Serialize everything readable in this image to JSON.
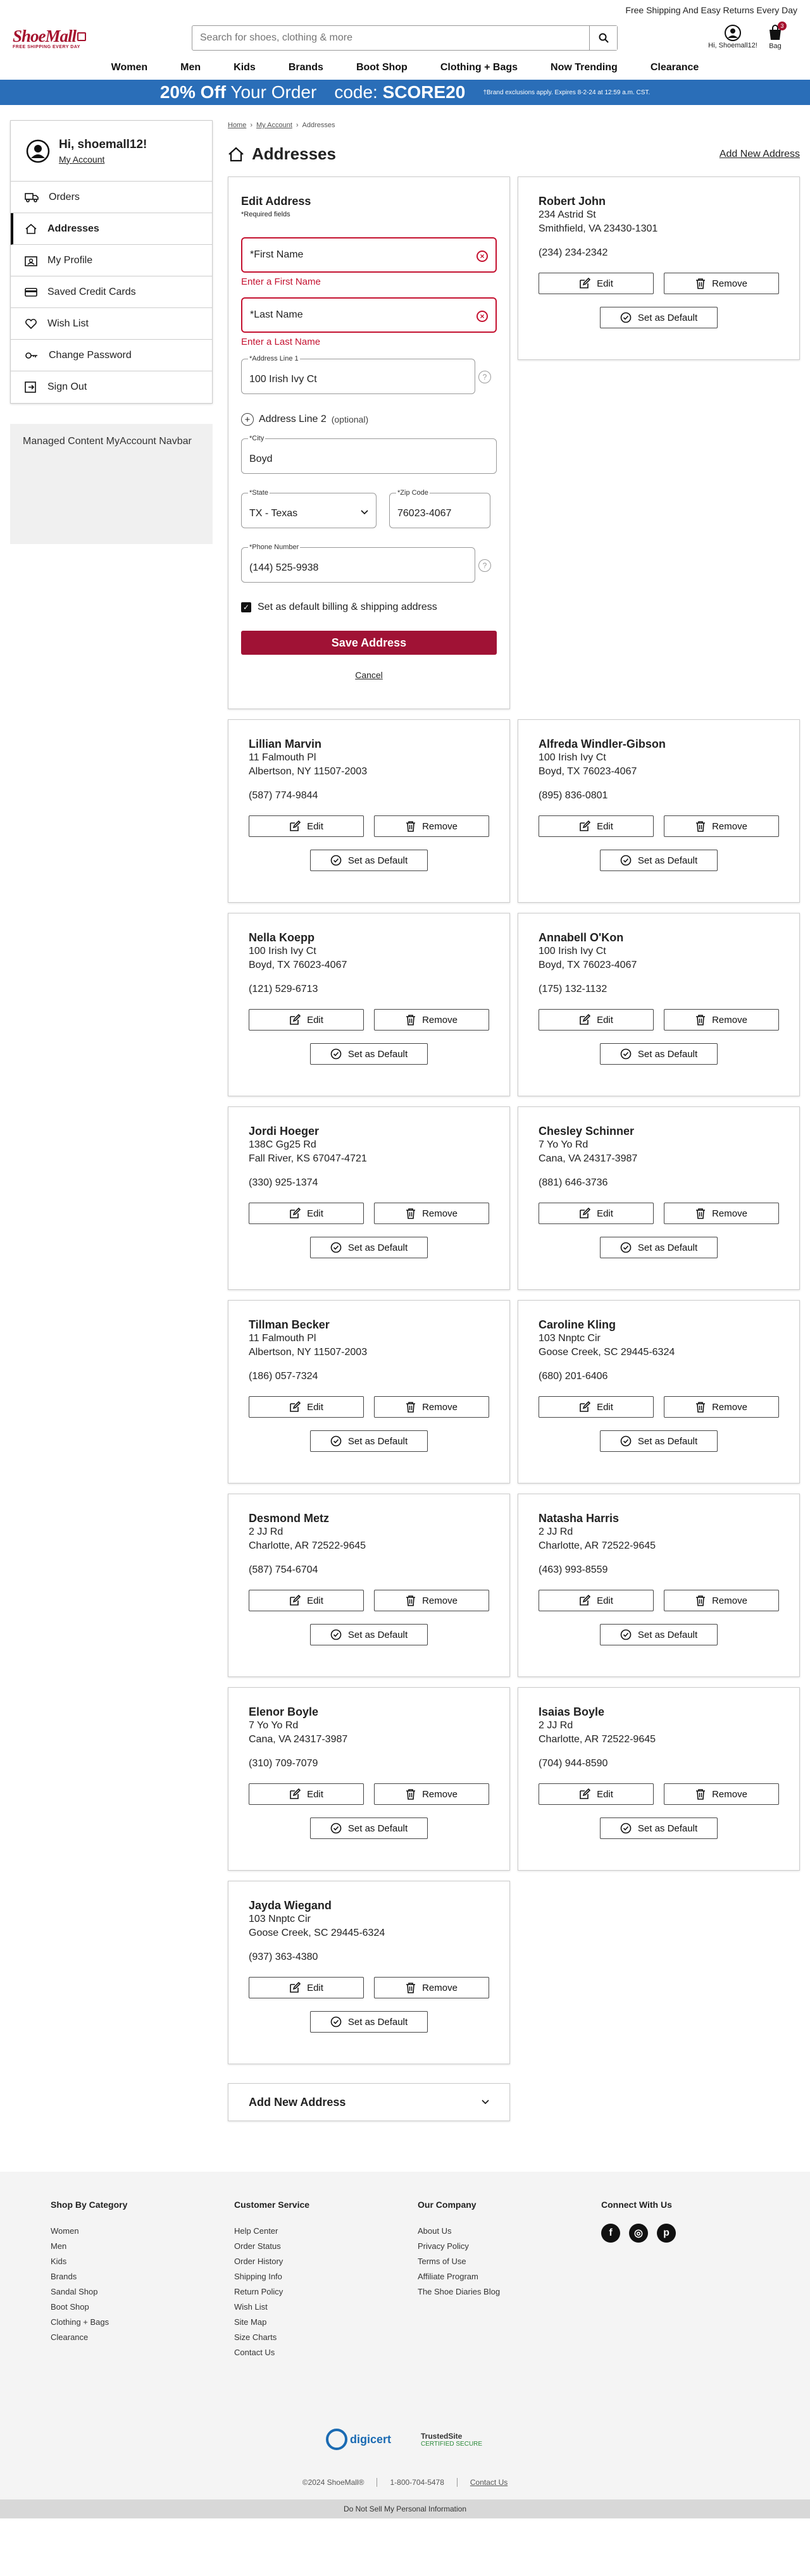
{
  "top_strip": "Free Shipping And Easy Returns Every Day",
  "logo": {
    "text": "ShoeMall",
    "tagline": "FREE SHIPPING EVERY DAY"
  },
  "search": {
    "placeholder": "Search for shoes, clothing & more"
  },
  "account": {
    "label": "Hi, Shoemall12!"
  },
  "bag": {
    "label": "Bag",
    "count": "3"
  },
  "nav": [
    "Women",
    "Men",
    "Kids",
    "Brands",
    "Boot Shop",
    "Clothing + Bags",
    "Now Trending",
    "Clearance"
  ],
  "promo": {
    "percent": "20% Off",
    "rest": "Your Order",
    "code_label": "code:",
    "code": "SCORE20",
    "note": "†Brand exclusions apply. Expires 8-2-24 at 12:59 a.m. CST."
  },
  "sidebar": {
    "greeting": "Hi, shoemall12!",
    "my_account": "My Account",
    "items": [
      {
        "label": "Orders",
        "icon": "truck-icon"
      },
      {
        "label": "Addresses",
        "icon": "home-icon"
      },
      {
        "label": "My Profile",
        "icon": "profile-icon"
      },
      {
        "label": "Saved Credit Cards",
        "icon": "credit-card-icon"
      },
      {
        "label": "Wish List",
        "icon": "heart-icon"
      },
      {
        "label": "Change Password",
        "icon": "key-icon"
      },
      {
        "label": "Sign Out",
        "icon": "sign-out-icon"
      }
    ],
    "managed": "Managed Content MyAccount Navbar"
  },
  "breadcrumb": [
    "Home",
    "My Account",
    "Addresses"
  ],
  "page_title": "Addresses",
  "add_new_link": "Add New Address",
  "form": {
    "title": "Edit Address",
    "required_note": "*Required fields",
    "first_name_placeholder": "*First Name",
    "first_name_error": "Enter a First Name",
    "last_name_placeholder": "*Last Name",
    "last_name_error": "Enter a Last Name",
    "address1_label": "*Address Line 1",
    "address1_value": "100 Irish Ivy Ct",
    "address2_label": "Address Line 2",
    "address2_optional": "(optional)",
    "city_label": "*City",
    "city_value": "Boyd",
    "state_label": "*State",
    "state_value": "TX - Texas",
    "zip_label": "*Zip Code",
    "zip_value": "76023-4067",
    "phone_label": "*Phone Number",
    "phone_value": "(144) 525-9938",
    "default_label": "Set as default billing & shipping address",
    "save_label": "Save Address",
    "cancel_label": "Cancel"
  },
  "buttons": {
    "edit": "Edit",
    "remove": "Remove",
    "default": "Set as Default"
  },
  "addresses": [
    {
      "name": "Robert John",
      "street": "234 Astrid St",
      "city": "Smithfield, VA 23430-1301",
      "phone": "(234) 234-2342"
    },
    {
      "name": "Lillian Marvin",
      "street": "11 Falmouth Pl",
      "city": "Albertson, NY 11507-2003",
      "phone": "(587) 774-9844"
    },
    {
      "name": "Alfreda Windler-Gibson",
      "street": "100 Irish Ivy Ct",
      "city": "Boyd, TX 76023-4067",
      "phone": "(895) 836-0801"
    },
    {
      "name": "Nella Koepp",
      "street": "100 Irish Ivy Ct",
      "city": "Boyd, TX 76023-4067",
      "phone": "(121) 529-6713"
    },
    {
      "name": "Annabell O'Kon",
      "street": "100 Irish Ivy Ct",
      "city": "Boyd, TX 76023-4067",
      "phone": "(175) 132-1132"
    },
    {
      "name": "Jordi Hoeger",
      "street": "138C Gg25 Rd",
      "city": "Fall River, KS 67047-4721",
      "phone": "(330) 925-1374"
    },
    {
      "name": "Chesley Schinner",
      "street": "7 Yo Yo Rd",
      "city": "Cana, VA 24317-3987",
      "phone": "(881) 646-3736"
    },
    {
      "name": "Tillman Becker",
      "street": "11 Falmouth Pl",
      "city": "Albertson, NY 11507-2003",
      "phone": "(186) 057-7324"
    },
    {
      "name": "Caroline Kling",
      "street": "103 Nnptc Cir",
      "city": "Goose Creek, SC 29445-6324",
      "phone": "(680) 201-6406"
    },
    {
      "name": "Desmond Metz",
      "street": "2 JJ Rd",
      "city": "Charlotte, AR 72522-9645",
      "phone": "(587) 754-6704"
    },
    {
      "name": "Natasha Harris",
      "street": "2 JJ Rd",
      "city": "Charlotte, AR 72522-9645",
      "phone": "(463) 993-8559"
    },
    {
      "name": "Elenor Boyle",
      "street": "7 Yo Yo Rd",
      "city": "Cana, VA 24317-3987",
      "phone": "(310) 709-7079"
    },
    {
      "name": "Isaias Boyle",
      "street": "2 JJ Rd",
      "city": "Charlotte, AR 72522-9645",
      "phone": "(704) 944-8590"
    },
    {
      "name": "Jayda Wiegand",
      "street": "103 Nnptc Cir",
      "city": "Goose Creek, SC 29445-6324",
      "phone": "(937) 363-4380"
    }
  ],
  "add_bar": "Add New Address",
  "footer": {
    "columns": [
      {
        "title": "Shop By Category",
        "links": [
          "Women",
          "Men",
          "Kids",
          "Brands",
          "Sandal Shop",
          "Boot Shop",
          "Clothing + Bags",
          "Clearance"
        ]
      },
      {
        "title": "Customer Service",
        "links": [
          "Help Center",
          "Order Status",
          "Order History",
          "Shipping Info",
          "Return Policy",
          "Wish List",
          "Site Map",
          "Size Charts",
          "Contact Us"
        ]
      },
      {
        "title": "Our Company",
        "links": [
          "About Us",
          "Privacy Policy",
          "Terms of Use",
          "Affiliate Program",
          "The Shoe Diaries Blog"
        ]
      }
    ],
    "connect_title": "Connect With Us",
    "social": [
      "facebook-icon",
      "instagram-icon",
      "pinterest-icon"
    ],
    "digicert": "digicert",
    "trusted_site": "TrustedSite",
    "trusted_sub": "CERTIFIED SECURE",
    "copyright": "©2024 ShoeMall®",
    "phone": "1-800-704-5478",
    "contact": "Contact Us",
    "bottom": "Do Not Sell My Personal Information"
  },
  "colors": {
    "brand": "#a5122e",
    "promo": "#2a6eb8",
    "error": "#c41230"
  }
}
